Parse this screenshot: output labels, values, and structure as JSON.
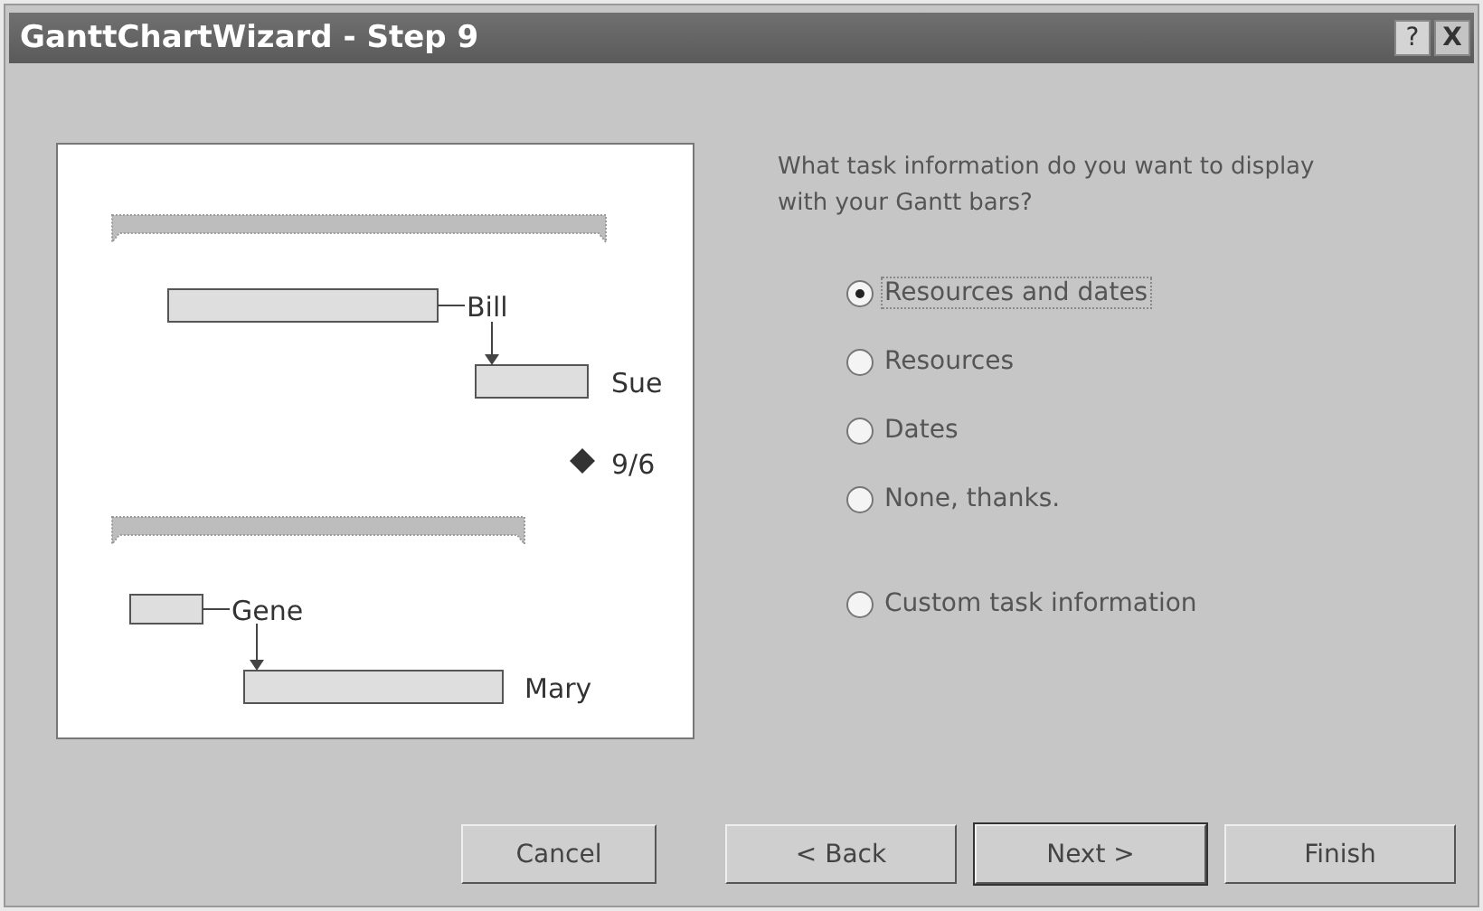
{
  "window": {
    "title": "GanttChartWizard - Step 9",
    "controls": [
      {
        "kind": "help",
        "label": "?"
      },
      {
        "kind": "close",
        "label": "X"
      }
    ]
  },
  "preview": {
    "items": [
      {
        "kind": "summary"
      },
      {
        "kind": "task",
        "label": "Bill"
      },
      {
        "kind": "task",
        "label": "Sue"
      },
      {
        "kind": "milestone",
        "label": "9/6"
      },
      {
        "kind": "summary"
      },
      {
        "kind": "task",
        "label": "Gene"
      },
      {
        "kind": "task",
        "label": "Mary"
      }
    ]
  },
  "question": "What task information do you want to display with your Gantt bars?",
  "options": [
    {
      "label": "Resources and dates",
      "selected": true
    },
    {
      "label": "Resources",
      "selected": false
    },
    {
      "label": "Dates",
      "selected": false
    },
    {
      "label": "None, thanks.",
      "selected": false
    },
    {
      "label": "Custom task information",
      "selected": false
    }
  ],
  "buttons": [
    {
      "label": "Cancel",
      "default": false
    },
    {
      "label": "< Back",
      "default": false
    },
    {
      "label": "Next >",
      "default": true
    },
    {
      "label": "Finish",
      "default": false
    }
  ]
}
